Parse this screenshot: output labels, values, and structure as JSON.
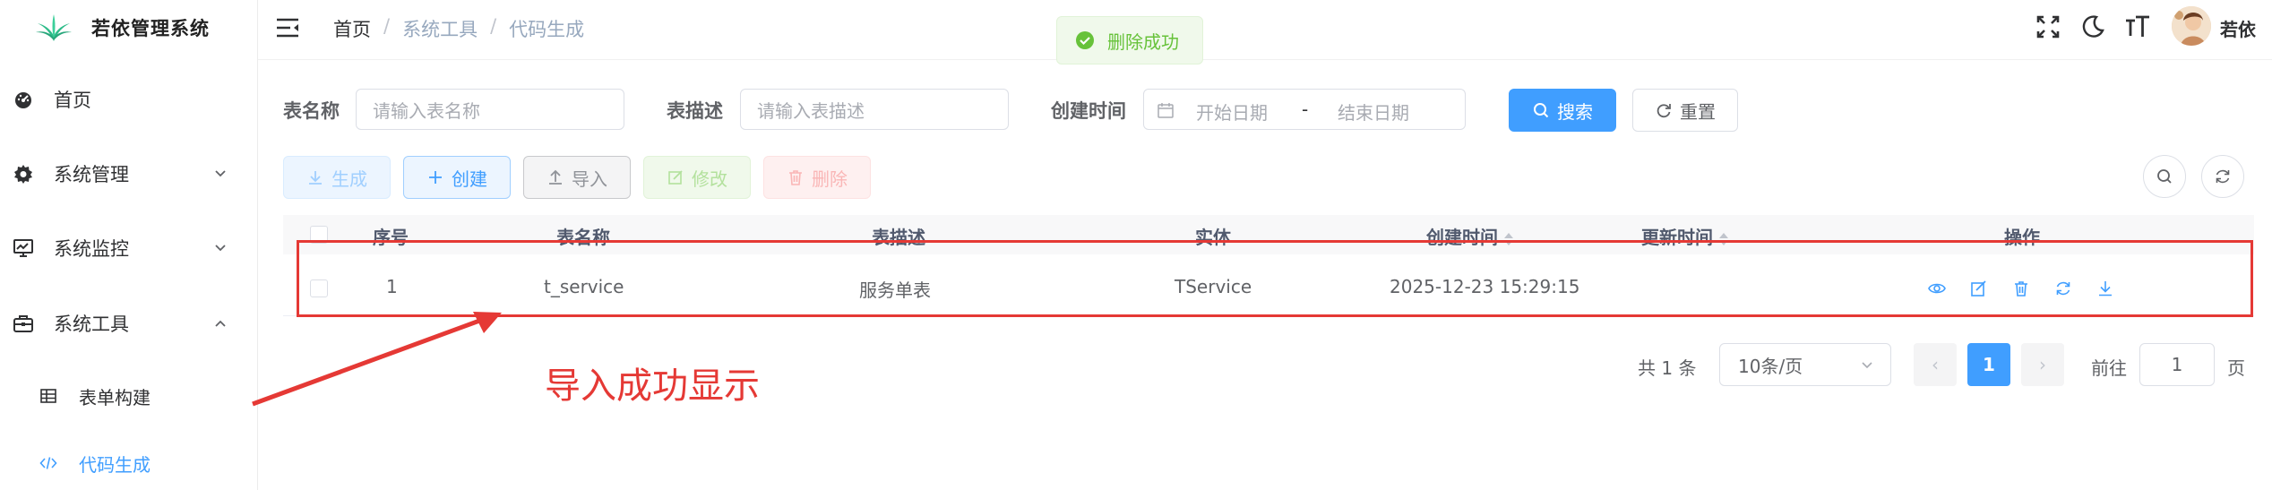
{
  "app": {
    "title": "若依管理系统"
  },
  "sidebar": {
    "items": [
      {
        "label": "首页",
        "icon": "dashboard-icon"
      },
      {
        "label": "系统管理",
        "icon": "gear-icon"
      },
      {
        "label": "系统监控",
        "icon": "monitor-icon"
      },
      {
        "label": "系统工具",
        "icon": "toolbox-icon"
      }
    ],
    "sub_items": [
      {
        "label": "表单构建",
        "icon": "table-grid-icon"
      },
      {
        "label": "代码生成",
        "icon": "code-icon"
      }
    ]
  },
  "header": {
    "breadcrumb": [
      "首页",
      "系统工具",
      "代码生成"
    ],
    "user_name": "若依"
  },
  "toast": {
    "text": "删除成功"
  },
  "search": {
    "table_name_label": "表名称",
    "table_name_placeholder": "请输入表名称",
    "table_desc_label": "表描述",
    "table_desc_placeholder": "请输入表描述",
    "create_time_label": "创建时间",
    "start_placeholder": "开始日期",
    "date_separator": "-",
    "end_placeholder": "结束日期",
    "search_label": "搜索",
    "reset_label": "重置"
  },
  "toolbar": {
    "generate_label": "生成",
    "create_label": "创建",
    "import_label": "导入",
    "edit_label": "修改",
    "delete_label": "删除"
  },
  "table": {
    "headers": [
      "序号",
      "表名称",
      "表描述",
      "实体",
      "创建时间",
      "更新时间",
      "操作"
    ],
    "rows": [
      {
        "index": "1",
        "table_name": "t_service",
        "table_desc": "服务单表",
        "entity": "TService",
        "create_time": "2025-12-23 15:29:15",
        "update_time": ""
      }
    ]
  },
  "annotation": {
    "text": "导入成功显示",
    "color": "#e53935"
  },
  "pagination": {
    "total": "共 1 条",
    "page_size": "10条/页",
    "prev": "‹",
    "current": "1",
    "next": "›",
    "goto_label": "前往",
    "goto_value": "1",
    "page_suffix": "页"
  },
  "colors": {
    "primary": "#409eff",
    "success": "#67c23a",
    "danger": "#f56c6c"
  }
}
